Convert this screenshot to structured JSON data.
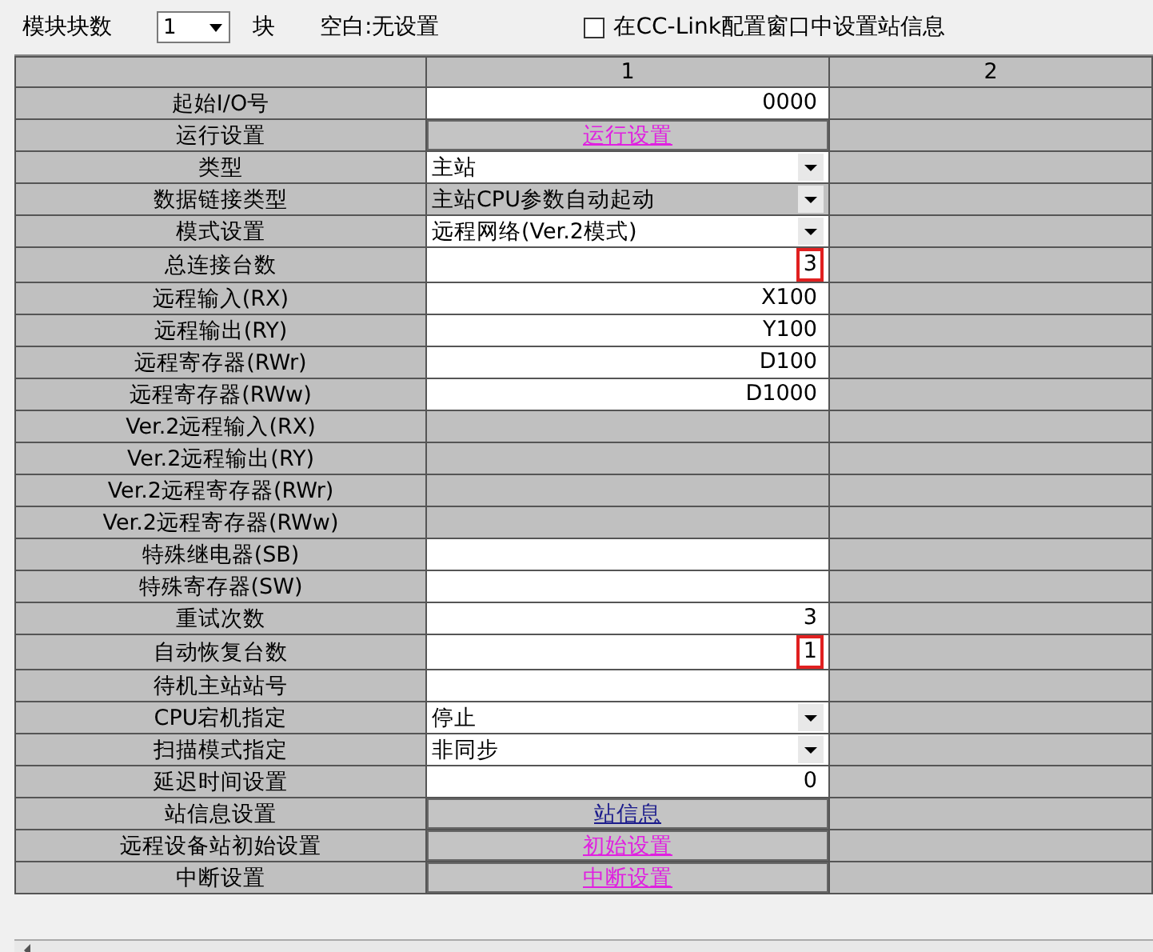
{
  "toolbar": {
    "module_count_label": "模块块数",
    "module_count": "1",
    "unit": "块",
    "blank_note": "空白:无设置",
    "station_info_checkbox": {
      "label": "在CC-Link配置窗口中设置站信息",
      "checked": false
    }
  },
  "table": {
    "columns": [
      "1",
      "2"
    ],
    "rows": [
      {
        "label": "起始I/O号",
        "kind": "input",
        "value": "0000",
        "highlighted": false
      },
      {
        "label": "运行设置",
        "kind": "button",
        "value": "运行设置",
        "color": "#e020e0"
      },
      {
        "label": "类型",
        "kind": "select",
        "value": "主站"
      },
      {
        "label": "数据链接类型",
        "kind": "select-disabled",
        "value": "主站CPU参数自动起动"
      },
      {
        "label": "模式设置",
        "kind": "select",
        "value": "远程网络(Ver.2模式)"
      },
      {
        "label": "总连接台数",
        "kind": "input",
        "value": "3",
        "highlighted": true
      },
      {
        "label": "远程输入(RX)",
        "kind": "input",
        "value": "X100",
        "highlighted": false
      },
      {
        "label": "远程输出(RY)",
        "kind": "input",
        "value": "Y100",
        "highlighted": false
      },
      {
        "label": "远程寄存器(RWr)",
        "kind": "input",
        "value": "D100",
        "highlighted": false
      },
      {
        "label": "远程寄存器(RWw)",
        "kind": "input",
        "value": "D1000",
        "highlighted": false
      },
      {
        "label": "Ver.2远程输入(RX)",
        "kind": "disabled"
      },
      {
        "label": "Ver.2远程输出(RY)",
        "kind": "disabled"
      },
      {
        "label": "Ver.2远程寄存器(RWr)",
        "kind": "disabled"
      },
      {
        "label": "Ver.2远程寄存器(RWw)",
        "kind": "disabled"
      },
      {
        "label": "特殊继电器(SB)",
        "kind": "input"
      },
      {
        "label": "特殊寄存器(SW)",
        "kind": "input"
      },
      {
        "label": "重试次数",
        "kind": "input",
        "value": "3",
        "highlighted": false
      },
      {
        "label": "自动恢复台数",
        "kind": "input",
        "value": "1",
        "highlighted": true
      },
      {
        "label": "待机主站站号",
        "kind": "input"
      },
      {
        "label": "CPU宕机指定",
        "kind": "select",
        "value": "停止"
      },
      {
        "label": "扫描模式指定",
        "kind": "select",
        "value": "非同步"
      },
      {
        "label": "延迟时间设置",
        "kind": "input",
        "value": "0",
        "highlighted": false
      },
      {
        "label": "站信息设置",
        "kind": "button",
        "value": "站信息",
        "color": "#1c1c8c"
      },
      {
        "label": "远程设备站初始设置",
        "kind": "button",
        "value": "初始设置",
        "color": "#e020e0"
      },
      {
        "label": "中断设置",
        "kind": "button",
        "value": "中断设置",
        "color": "#e020e0"
      }
    ]
  }
}
